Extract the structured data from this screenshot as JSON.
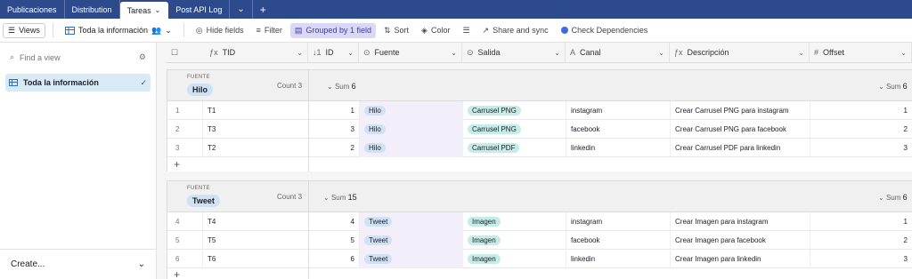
{
  "tabs": [
    {
      "label": "Publicaciones"
    },
    {
      "label": "Distribution"
    },
    {
      "label": "Tareas",
      "active": true
    },
    {
      "label": "Post API Log"
    }
  ],
  "toolbar": {
    "views_label": "Views",
    "view_name": "Toda la información",
    "hide_fields": "Hide fields",
    "filter": "Filter",
    "grouped": "Grouped by 1 field",
    "sort": "Sort",
    "color": "Color",
    "share": "Share and sync",
    "check": "Check Dependencies"
  },
  "sidebar": {
    "find_placeholder": "Find a view",
    "views": [
      {
        "label": "Toda la información",
        "selected": true
      }
    ],
    "create_label": "Create..."
  },
  "columns": {
    "tid": "TID",
    "id": "ID",
    "fuente": "Fuente",
    "salida": "Salida",
    "canal": "Canal",
    "descripcion": "Descripción",
    "offset": "Offset"
  },
  "groups": [
    {
      "field_label": "FUENTE",
      "value": "Hilo",
      "count_label": "Count",
      "count": "3",
      "id_sum_label": "Sum",
      "id_sum": "6",
      "offset_sum_label": "Sum",
      "offset_sum": "6",
      "rows": [
        {
          "n": "1",
          "tid": "T1",
          "id": "1",
          "fuente": "Hilo",
          "salida": "Carrusel PNG",
          "canal": "instagram",
          "descripcion": "Crear Carrusel PNG para instagram",
          "offset": "1"
        },
        {
          "n": "2",
          "tid": "T3",
          "id": "3",
          "fuente": "Hilo",
          "salida": "Carrusel PNG",
          "canal": "facebook",
          "descripcion": "Crear Carrusel PNG para facebook",
          "offset": "2"
        },
        {
          "n": "3",
          "tid": "T2",
          "id": "2",
          "fuente": "Hilo",
          "salida": "Carrusel PDF",
          "canal": "linkedin",
          "descripcion": "Crear Carrusel PDF para linkedin",
          "offset": "3"
        }
      ]
    },
    {
      "field_label": "FUENTE",
      "value": "Tweet",
      "count_label": "Count",
      "count": "3",
      "id_sum_label": "Sum",
      "id_sum": "15",
      "offset_sum_label": "Sum",
      "offset_sum": "6",
      "rows": [
        {
          "n": "4",
          "tid": "T4",
          "id": "4",
          "fuente": "Tweet",
          "salida": "Imagen",
          "canal": "instagram",
          "descripcion": "Crear Imagen para instagram",
          "offset": "1"
        },
        {
          "n": "5",
          "tid": "T5",
          "id": "5",
          "fuente": "Tweet",
          "salida": "Imagen",
          "canal": "facebook",
          "descripcion": "Crear Imagen para facebook",
          "offset": "2"
        },
        {
          "n": "6",
          "tid": "T6",
          "id": "6",
          "fuente": "Tweet",
          "salida": "Imagen",
          "canal": "linkedin",
          "descripcion": "Crear Imagen para linkedin",
          "offset": "3"
        }
      ]
    }
  ],
  "colors": {
    "tabbar": "#2d4a8c",
    "grouped_bg": "#d9d8f5",
    "fuente_pill": "#cfe2f5",
    "salida_pill": "#c5ece7",
    "selected_view": "#d9eaf7"
  }
}
